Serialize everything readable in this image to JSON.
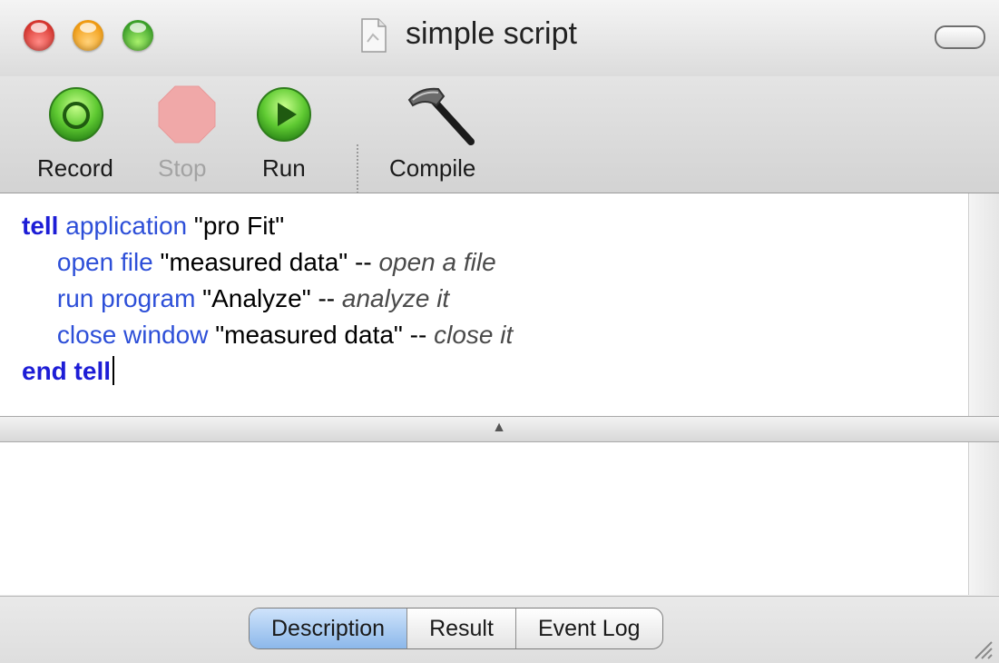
{
  "window": {
    "title": "simple script"
  },
  "toolbar": {
    "record_label": "Record",
    "stop_label": "Stop",
    "run_label": "Run",
    "compile_label": "Compile"
  },
  "editor": {
    "lines": [
      [
        {
          "text": "tell",
          "style": "kw"
        },
        {
          "text": " application",
          "style": "cmd"
        },
        {
          "text": " \"pro Fit\"",
          "style": "str"
        }
      ],
      [
        {
          "text": "     open file",
          "style": "cmd"
        },
        {
          "text": " \"measured data\"",
          "style": "str"
        },
        {
          "text": " -- ",
          "style": "str"
        },
        {
          "text": "open a file",
          "style": "cmt"
        }
      ],
      [
        {
          "text": "     run program",
          "style": "cmd"
        },
        {
          "text": " \"Analyze\"",
          "style": "str"
        },
        {
          "text": " -- ",
          "style": "str"
        },
        {
          "text": "analyze it",
          "style": "cmt"
        }
      ],
      [
        {
          "text": "     close window",
          "style": "cmd"
        },
        {
          "text": " \"measured data\"",
          "style": "str"
        },
        {
          "text": " -- ",
          "style": "str"
        },
        {
          "text": "close it",
          "style": "cmt"
        }
      ],
      [
        {
          "text": "end tell",
          "style": "kw"
        }
      ]
    ]
  },
  "tabs": {
    "items": [
      "Description",
      "Result",
      "Event Log"
    ],
    "active": "Description"
  },
  "icons": {
    "record": "record-icon",
    "stop": "stop-icon",
    "run": "run-icon",
    "compile": "hammer-icon",
    "document": "script-document-icon"
  }
}
